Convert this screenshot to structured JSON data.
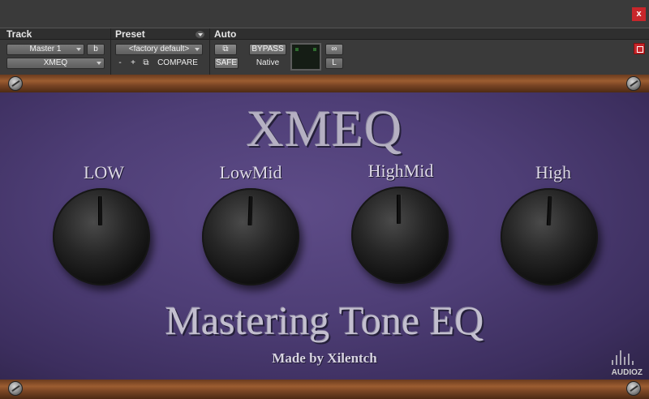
{
  "window": {
    "close_label": "x"
  },
  "header": {
    "track_label": "Track",
    "preset_label": "Preset",
    "auto_label": "Auto",
    "track_name": "Master 1",
    "track_variant": "b",
    "insert_name": "XMEQ",
    "preset_value": "<factory default>",
    "minus_label": "-",
    "plus_label": "+",
    "compare_label": "COMPARE",
    "bypass_label": "BYPASS",
    "safe_label": "SAFE",
    "native_label": "Native",
    "channel_value": "L"
  },
  "plugin": {
    "logo": "XMEQ",
    "subtitle": "Mastering Tone EQ",
    "credit": "Made by Xilentch",
    "knobs": [
      {
        "label": "LOW",
        "rotation_deg": 0
      },
      {
        "label": "LowMid",
        "rotation_deg": 2
      },
      {
        "label": "HighMid",
        "rotation_deg": 0
      },
      {
        "label": "High",
        "rotation_deg": 3
      }
    ]
  },
  "watermark": "AUDIOZ"
}
